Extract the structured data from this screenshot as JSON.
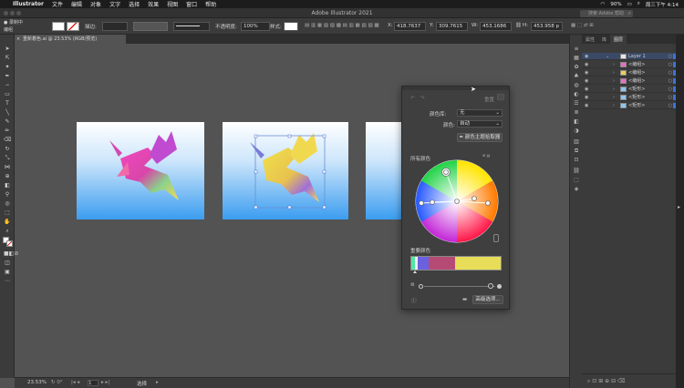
{
  "menubar": {
    "apple": "",
    "app": "Illustrator",
    "items": [
      "文件",
      "编辑",
      "对象",
      "文字",
      "选择",
      "效果",
      "视图",
      "窗口",
      "帮助"
    ],
    "battery": "90%",
    "datetime": "周三下午 4:14"
  },
  "window": {
    "title": "Adobe Illustrator 2021",
    "search_placeholder": "搜索 Adobe 帮助"
  },
  "control": {
    "mode": "编组",
    "stroke_label": "描边:",
    "opacity_label": "不透明度:",
    "opacity_value": "100%",
    "style_label": "样式:",
    "x": "418.7637",
    "y": "309.7615",
    "w": "453.1686",
    "h": "453.958 p"
  },
  "document": {
    "tab": "重新着色.ai @ 23.53% (RGB/预览)",
    "zoom": "23.53%",
    "page": "1",
    "tool": "选择"
  },
  "layers": {
    "tabs": [
      "属性",
      "库",
      "图层"
    ],
    "rows": [
      {
        "name": "Layer 1",
        "thumb": "#e6e6e6"
      },
      {
        "name": "<编组>",
        "thumb": "#e96fbf"
      },
      {
        "name": "<编组>",
        "thumb": "#eecf5a"
      },
      {
        "name": "<编组>",
        "thumb": "#e96fbf"
      },
      {
        "name": "<矩形>",
        "thumb": "#8cc6f2"
      },
      {
        "name": "<矩形>",
        "thumb": "#8cc6f2"
      },
      {
        "name": "<矩形>",
        "thumb": "#8cc6f2"
      }
    ]
  },
  "recolor": {
    "reset": "重置",
    "library_label": "颜色库:",
    "library_value": "无",
    "colors_label": "颜色:",
    "colors_value": "自动",
    "theme_picker": "颜色主题拾取器",
    "all_colors": "所有颜色",
    "important_colors": "重要颜色",
    "advanced_btn": "高级选项...",
    "swatches": [
      {
        "color": "#51e8a5",
        "w": 4
      },
      {
        "color": "#f4f4f4",
        "w": 3
      },
      {
        "color": "#6a61df",
        "w": 11
      },
      {
        "color": "#b54b74",
        "w": 29
      },
      {
        "color": "#e8dd59",
        "w": 48
      }
    ]
  },
  "colors": {
    "accent": "#3b73d8",
    "panel": "#3f3f3f",
    "canvas": "#535353"
  }
}
